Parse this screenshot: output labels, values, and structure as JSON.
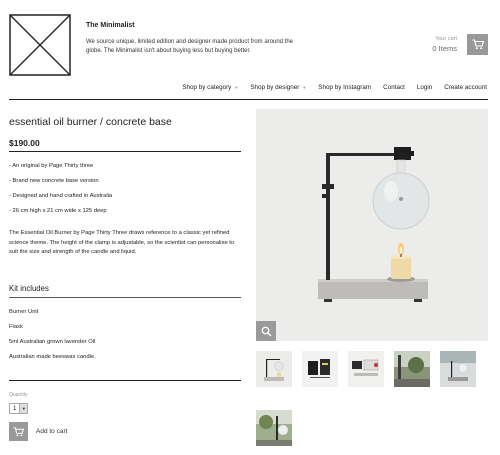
{
  "header": {
    "brand_title": "The Minimalist",
    "brand_description": "We source unique, limited edition and designer made product from around the globe. The Minimalist isn't about buying less but buying better.",
    "cart_label": "Your cart",
    "cart_count": "0 Items",
    "cart_icon": "cart-icon",
    "logo_icon": "x-box-logo"
  },
  "nav": {
    "items": [
      {
        "label": "Shop by category",
        "has_caret": true
      },
      {
        "label": "Shop by designer",
        "has_caret": true
      },
      {
        "label": "Shop by Instagram",
        "has_caret": false
      },
      {
        "label": "Contact",
        "has_caret": false
      },
      {
        "label": "Login",
        "has_caret": false
      },
      {
        "label": "Create account",
        "has_caret": false
      }
    ]
  },
  "product": {
    "title": "essential oil burner / concrete base",
    "price": "$190.00",
    "features": [
      "- An original by Page Thirty three",
      "- Brand new concrete base version",
      "- Designed and hand crafted in Australia",
      "- 26 cm high x 21 cm wide x 125 deep"
    ],
    "description": "The Essential Oil Burner by Page Thirty Three draws reference to a classic yet refined science theme. The height of the clamp is adjustable, so the scientist can personalise to suit the size and strength of the candle and liquid.",
    "kit_heading": "Kit includes",
    "kit_items": [
      "Burner Unit",
      "Flask",
      "5ml Australian grown lavender Oil",
      "Australian made beeswax candle."
    ],
    "quantity_label": "Quantity",
    "quantity_value": "1",
    "add_to_cart_label": "Add to cart"
  },
  "colors": {
    "button_grey": "#999999",
    "image_bg": "#ececea"
  }
}
